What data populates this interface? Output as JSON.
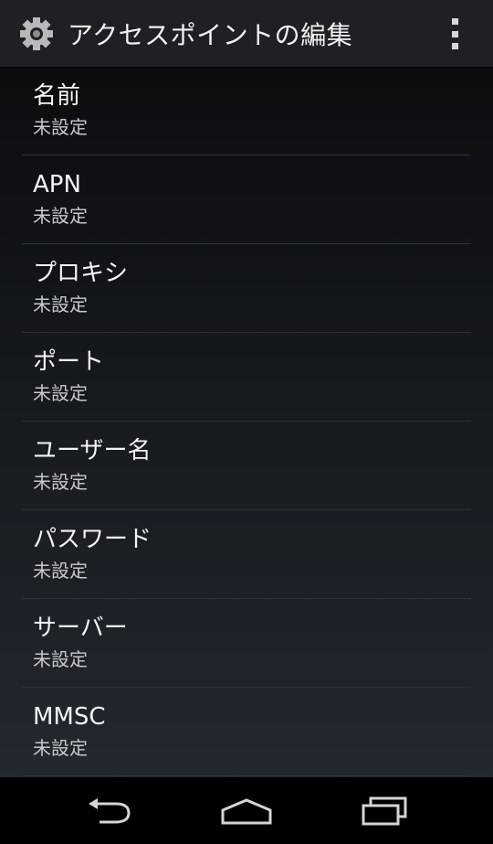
{
  "action_bar": {
    "title": "アクセスポイントの編集",
    "app_icon": "settings-gear-icon",
    "overflow_icon": "overflow-menu-icon"
  },
  "fields": [
    {
      "label": "名前",
      "value": "未設定"
    },
    {
      "label": "APN",
      "value": "未設定"
    },
    {
      "label": "プロキシ",
      "value": "未設定"
    },
    {
      "label": "ポート",
      "value": "未設定"
    },
    {
      "label": "ユーザー名",
      "value": "未設定"
    },
    {
      "label": "パスワード",
      "value": "未設定"
    },
    {
      "label": "サーバー",
      "value": "未設定"
    },
    {
      "label": "MMSC",
      "value": "未設定"
    }
  ],
  "navigation": {
    "back_icon": "back-icon",
    "home_icon": "home-icon",
    "recents_icon": "recent-apps-icon"
  },
  "colors": {
    "action_bar": "#1f2023",
    "background_top": "#090a0c",
    "background_bottom": "#262b32",
    "primary_text": "#f5f5f5",
    "secondary_text": "#c8c8c8",
    "divider": "#2e3237"
  }
}
